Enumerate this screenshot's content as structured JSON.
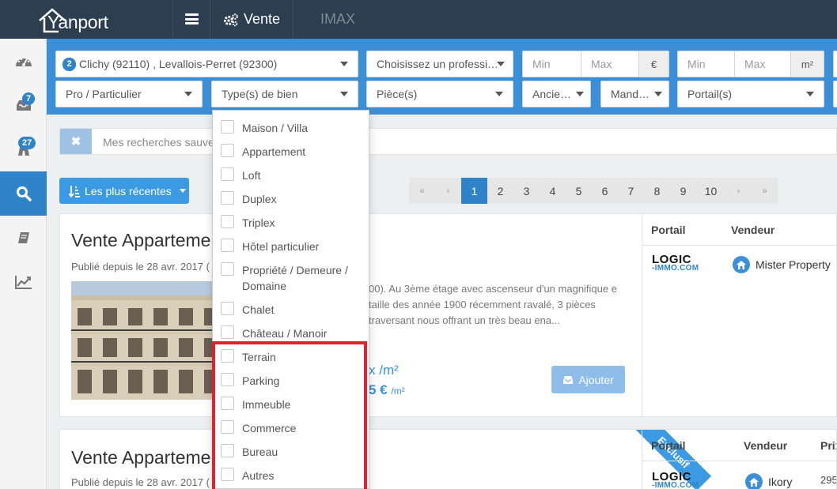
{
  "app": {
    "logo_text": "Yanport"
  },
  "nav": {
    "vente_label": "Vente",
    "imax_label": "IMAX"
  },
  "sidebar": {
    "items": [
      {
        "name": "dashboard-icon",
        "badge": null
      },
      {
        "name": "inbox-icon",
        "badge": "7"
      },
      {
        "name": "map-icon",
        "badge": "27"
      },
      {
        "name": "search-icon",
        "badge": null,
        "active": true
      },
      {
        "name": "book-icon",
        "badge": null
      },
      {
        "name": "chart-icon",
        "badge": null
      }
    ]
  },
  "filters": {
    "location_count": "2",
    "location_text": "Clichy (92110) , Levallois-Perret (92300)",
    "professional_placeholder": "Choisissez un professi…",
    "price_min": "Min",
    "price_max": "Max",
    "price_unit": "€",
    "surface_min": "Min",
    "surface_max": "Max",
    "surface_unit": "m²",
    "pro_part": "Pro / Particulier",
    "property_type": "Type(s) de bien",
    "rooms": "Pièce(s)",
    "age": "Ancie…",
    "mandate": "Mand…",
    "portals": "Portail(s)"
  },
  "saved_search": {
    "placeholder": "Mes recherches sauveg"
  },
  "sort": {
    "label": "Les plus récentes"
  },
  "pagination": {
    "first": "«",
    "prev": "‹",
    "pages": [
      "1",
      "2",
      "3",
      "4",
      "5",
      "6",
      "7",
      "8",
      "9",
      "10"
    ],
    "current": "1",
    "next": "›",
    "last": "»"
  },
  "dropdown": {
    "options": [
      "Maison / Villa",
      "Appartement",
      "Loft",
      "Duplex",
      "Triplex",
      "Hôtel particulier",
      "Propriété / Demeure / Domaine",
      "Chalet",
      "Château / Manoir",
      "Terrain",
      "Parking",
      "Immeuble",
      "Commerce",
      "Bureau",
      "Autres"
    ]
  },
  "listing1": {
    "title": "Vente Apparteme",
    "date": "Publié depuis le 28 avr. 2017 (",
    "description": "00). Au 3ème étage avec ascenseur d'un magnifique e taille des année 1900 récemment ravalé, 3 pièces traversant nous offrant un très beau ena...",
    "price_line1": "x /m²",
    "price_line2": "5 €",
    "price_line2_unit": "/m²",
    "add_button": "Ajouter",
    "portal_header": "Portail",
    "vendor_header": "Vendeur",
    "portal_logo_top": "LOGIC",
    "portal_logo_bottom": "-IMMO.COM",
    "vendor_name": "Mister Property"
  },
  "listing2": {
    "title": "Vente Apparteme",
    "date": "Publié depuis le 28 avr. 2017 (",
    "ribbon": "Exclusif",
    "portal_header": "Portail",
    "vendor_header": "Vendeur",
    "price_header": "Prix",
    "portal_logo_top": "LOGIC",
    "portal_logo_bottom": "-IMMO.COM",
    "vendor_name": "Ikory",
    "price_value": "295"
  }
}
